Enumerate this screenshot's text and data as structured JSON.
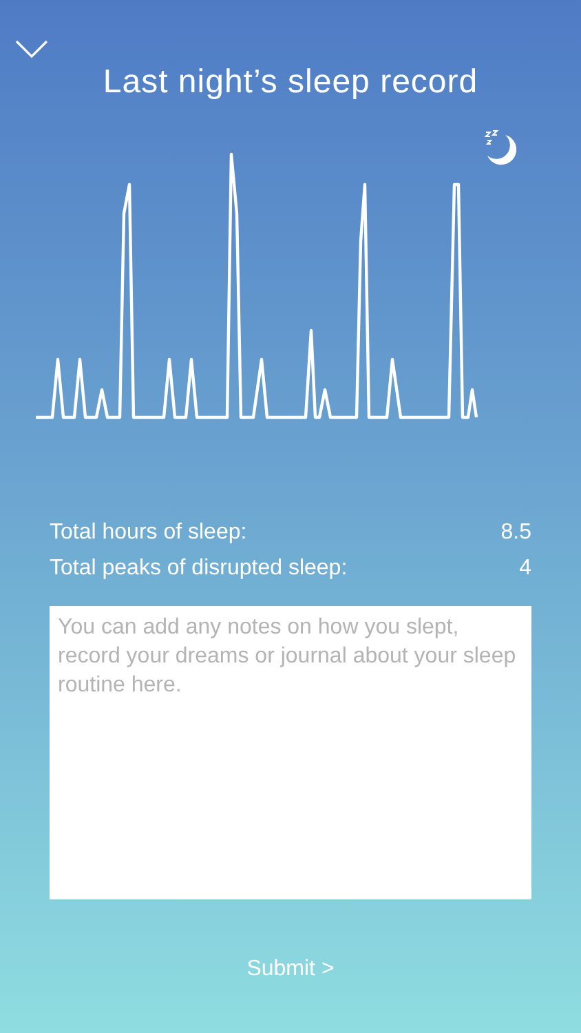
{
  "header": {
    "title": "Last night’s sleep record"
  },
  "stats": [
    {
      "label": "Total hours of sleep:",
      "value": "8.5"
    },
    {
      "label": "Total peaks of disrupted sleep:",
      "value": "4"
    }
  ],
  "notes": {
    "placeholder": "You can add any notes on how you slept, record your dreams or journal about your sleep routine here."
  },
  "submit": {
    "label": "Submit >"
  }
}
